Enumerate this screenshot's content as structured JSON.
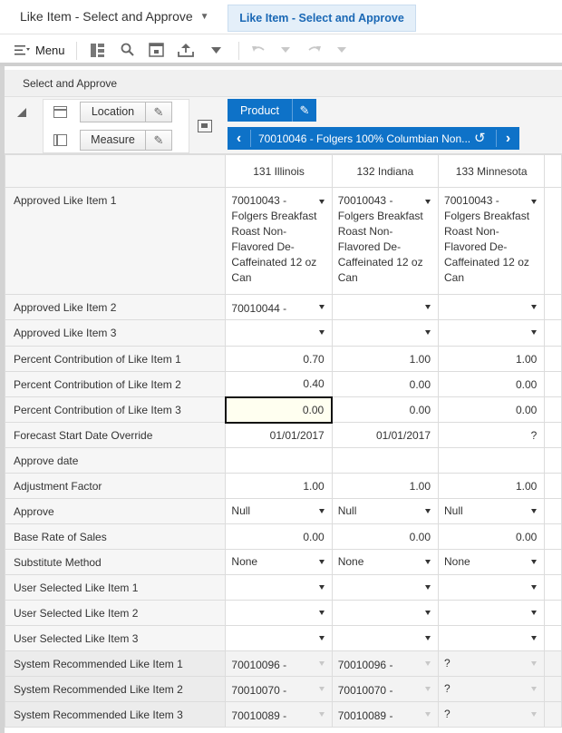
{
  "tabs": [
    {
      "label": "Like Item - Select and Approve"
    },
    {
      "label": "Like Item - Select and Approve"
    }
  ],
  "toolbar": {
    "menu_label": "Menu"
  },
  "section_title": "Select and Approve",
  "pivot": {
    "row_dims": [
      "Location",
      "Measure"
    ],
    "col_dim": "Product",
    "product_member": "70010046 - Folgers 100% Columbian Non..."
  },
  "columns": [
    "131 Illinois",
    "132 Indiana",
    "133 Minnesota"
  ],
  "rows": [
    {
      "label": "Approved Like Item 1",
      "type": "dd-wrap",
      "cells": [
        "70010043 - Folgers Breakfast Roast Non-Flavored De-Caffeinated 12 oz Can",
        "70010043 - Folgers Breakfast Roast Non-Flavored De-Caffeinated 12 oz Can",
        "70010043 - Folgers Breakfast Roast Non-Flavored De-Caffeinated 12 oz Can"
      ]
    },
    {
      "label": "Approved Like Item 2",
      "type": "dd",
      "cells": [
        "70010044 -",
        "",
        ""
      ]
    },
    {
      "label": "Approved Like Item 3",
      "type": "dd",
      "cells": [
        "",
        "",
        ""
      ]
    },
    {
      "label": "Percent Contribution of Like Item 1",
      "type": "num",
      "cells": [
        "0.70",
        "1.00",
        "1.00"
      ]
    },
    {
      "label": "Percent Contribution of Like Item 2",
      "type": "num",
      "cells": [
        "0.40",
        "0.00",
        "0.00"
      ]
    },
    {
      "label": "Percent Contribution of Like Item 3",
      "type": "num",
      "cells": [
        "0.00",
        "0.00",
        "0.00"
      ]
    },
    {
      "label": "Forecast Start Date Override",
      "type": "num",
      "cells": [
        "01/01/2017",
        "01/01/2017",
        "?"
      ]
    },
    {
      "label": "Approve date",
      "type": "num",
      "cells": [
        "",
        "",
        ""
      ]
    },
    {
      "label": "Adjustment Factor",
      "type": "num",
      "cells": [
        "1.00",
        "1.00",
        "1.00"
      ]
    },
    {
      "label": "Approve",
      "type": "dd",
      "cells": [
        "Null",
        "Null",
        "Null"
      ]
    },
    {
      "label": "Base Rate of Sales",
      "type": "num",
      "cells": [
        "0.00",
        "0.00",
        "0.00"
      ]
    },
    {
      "label": "Substitute Method",
      "type": "dd",
      "cells": [
        "None",
        "None",
        "None"
      ]
    },
    {
      "label": "User Selected Like Item 1",
      "type": "dd",
      "cells": [
        "",
        "",
        ""
      ]
    },
    {
      "label": "User Selected Like Item 2",
      "type": "dd",
      "cells": [
        "",
        "",
        ""
      ]
    },
    {
      "label": "User Selected Like Item 3",
      "type": "dd",
      "cells": [
        "",
        "",
        ""
      ]
    },
    {
      "label": "System Recommended Like Item 1",
      "type": "sys",
      "cells": [
        "70010096 -",
        "70010096 -",
        "?"
      ]
    },
    {
      "label": "System Recommended Like Item 2",
      "type": "sys",
      "cells": [
        "70010070 -",
        "70010070 -",
        "?"
      ]
    },
    {
      "label": "System Recommended Like Item 3",
      "type": "sys",
      "cells": [
        "70010089 -",
        "70010089 -",
        "?"
      ]
    }
  ],
  "selected_cell": {
    "row": 5,
    "col": 0
  }
}
